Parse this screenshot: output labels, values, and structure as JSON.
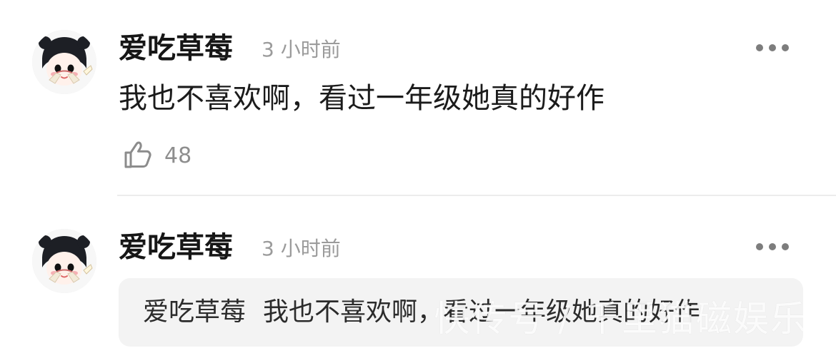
{
  "comments": [
    {
      "username": "爱吃草莓",
      "timestamp": "3 小时前",
      "content": "我也不喜欢啊，看过一年级她真的好作",
      "likes": "48"
    },
    {
      "username": "爱吃草莓",
      "timestamp": "3 小时前",
      "quoted_user": "爱吃草莓",
      "quoted_text": "我也不喜欢啊，看过一年级她真的好作"
    }
  ],
  "watermark": "快传号 / 千里猫磁娱乐",
  "icons": {
    "avatar": "avatar",
    "more": "more-icon",
    "like": "thumbs-up-icon"
  },
  "colors": {
    "text_primary": "#1b1b1b",
    "text_muted": "#9b9b9b",
    "divider": "#ececec",
    "quote_bg": "#f3f3f3"
  }
}
